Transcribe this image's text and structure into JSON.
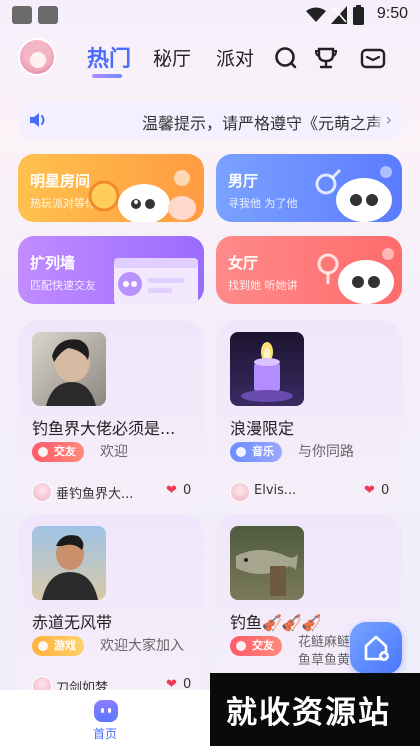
{
  "status_bar": {
    "time": "9:50",
    "icons": [
      "square-icon",
      "square-icon",
      "wifi-icon",
      "signal-icon",
      "battery-icon"
    ]
  },
  "top_nav": {
    "tabs": [
      {
        "label": "热门",
        "active": true
      },
      {
        "label": "秘厅",
        "active": false
      },
      {
        "label": "派对",
        "active": false
      }
    ],
    "icons": [
      "search-icon",
      "trophy-icon",
      "mail-icon"
    ],
    "accent_color": "#4b6bff"
  },
  "notice": {
    "text": "温馨提示，请严格遵守《元萌之声"
  },
  "rooms": [
    {
      "title": "明星房间",
      "subtitle": "热玩派对等你来",
      "color_from": "#ffc14d",
      "color_to": "#ff9b42"
    },
    {
      "title": "男厅",
      "subtitle": "寻我他  为了他",
      "color_from": "#7aa2ff",
      "color_to": "#5b7bff"
    },
    {
      "title": "扩列墙",
      "subtitle": "匹配快速交友",
      "color_from": "#c18cff",
      "color_to": "#9b6bff"
    },
    {
      "title": "女厅",
      "subtitle": "找到她  听她讲",
      "color_from": "#ff8a8a",
      "color_to": "#ff6b6b"
    }
  ],
  "posts": [
    {
      "title": "钓鱼界大佬必须是...",
      "tag": "交友",
      "tag_color": "#ff5a6a",
      "desc": "欢迎",
      "user": "垂钓鱼界大...",
      "likes": "0"
    },
    {
      "title": "浪漫限定",
      "tag": "音乐",
      "tag_color": "#6c8cff",
      "desc": "与你同路",
      "user": "Elvis...",
      "likes": "0"
    },
    {
      "title": "赤道无风带",
      "tag": "游戏",
      "tag_color": "#ffb23d",
      "desc": "欢迎大家加入",
      "user": "刀剑如梦",
      "likes": "0"
    },
    {
      "title": "钓鱼🎻🎻🎻",
      "tag": "交友",
      "tag_color": "#ff5a6a",
      "desc": "花鲢麻鲢翘嘴鳊鱼草鱼黄辣丁鮰鱼黑",
      "user": "",
      "likes": ""
    }
  ],
  "bottom_nav": {
    "home_label": "首页"
  },
  "watermark": {
    "text": "就收资源站"
  }
}
